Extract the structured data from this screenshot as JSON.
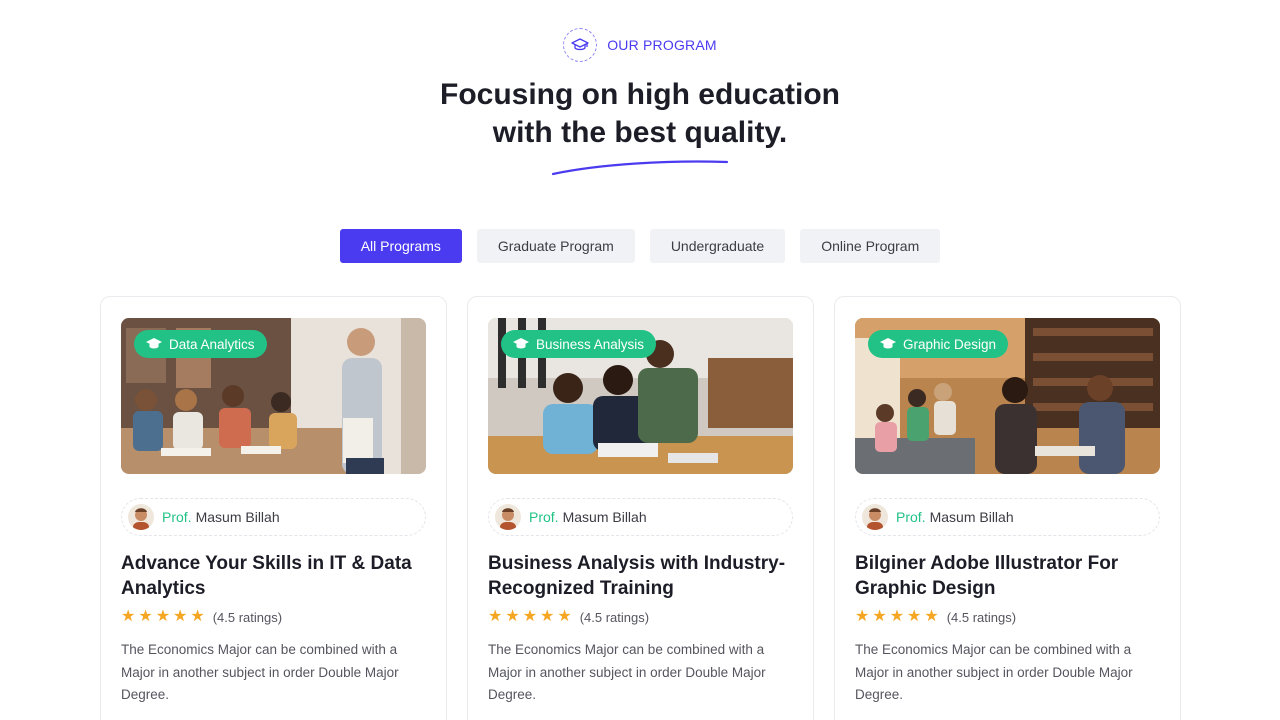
{
  "section": {
    "eyebrow": "OUR PROGRAM",
    "eyebrow_icon": "graduation-cap-icon",
    "heading_line1": "Focusing on high education",
    "heading_line2": "with the best quality.",
    "accent_color": "#4b3bf0"
  },
  "tabs": [
    {
      "label": "All Programs",
      "active": true
    },
    {
      "label": "Graduate Program",
      "active": false
    },
    {
      "label": "Undergraduate",
      "active": false
    },
    {
      "label": "Online Program",
      "active": false
    }
  ],
  "cards": [
    {
      "category": "Data Analytics",
      "prof_prefix": "Prof.",
      "instructor": "Masum Billah",
      "title": "Advance Your Skills in IT & Data Analytics",
      "stars": 5,
      "rating_text": "(4.5 ratings)",
      "description": "The Economics Major can be combined with a Major in another subject in order Double Major Degree."
    },
    {
      "category": "Business Analysis",
      "prof_prefix": "Prof.",
      "instructor": "Masum Billah",
      "title": "Business Analysis with Industry-Recognized Training",
      "stars": 5,
      "rating_text": "(4.5 ratings)",
      "description": "The Economics Major can be combined with a Major in another subject in order Double Major Degree."
    },
    {
      "category": "Graphic Design",
      "prof_prefix": "Prof.",
      "instructor": "Masum Billah",
      "title": "Bilginer Adobe Illustrator For Graphic Design",
      "stars": 5,
      "rating_text": "(4.5 ratings)",
      "description": "The Economics Major can be combined with a Major in another subject in order Double Major Degree."
    }
  ],
  "colors": {
    "green": "#22c286",
    "star": "#f5a623"
  }
}
